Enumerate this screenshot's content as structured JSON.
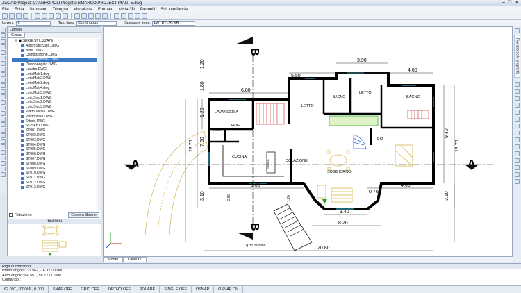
{
  "window": {
    "title": "ZwCAD Project: C:\\AGROPOLI Progetto SMARCO\\PROJECT PIANTE.dwg",
    "minimize": "–",
    "maximize": "□",
    "close": "✕"
  },
  "menu": [
    "File",
    "Edita",
    "Strumenti",
    "Disegna",
    "Visualizza",
    "Formato",
    "Vista 3D",
    "Pannelli",
    "Stili interfaccia"
  ],
  "properties_bar": {
    "layers_label": "Layers",
    "layers_value": "0",
    "linetype_label": "Tipo linea",
    "linetype_value": "Continuous",
    "lineweight_label": "Spessore linea",
    "lineweight_value": "LW_BYLAYER"
  },
  "library": {
    "header": "Librerie",
    "search_tab": "Cerca",
    "root_folder": "SERIE STILIZZATE",
    "items": [
      "AlberoStilizzato.DWG",
      "Bidet.DWG",
      "Composizione.DWG",
      "Composizione2.DWG",
      "DivanoAngolo.DWG",
      "Lavabo.DWG",
      "LettoMatr1.dwg",
      "LettoMatr2.DWG",
      "LettoMatr3.dwg",
      "LettoMatr4.dwg",
      "LettoMatr5.DWG",
      "LettoSing1.DWG",
      "LettoSing2.DWG",
      "LettoSing3.DWG",
      "PiattoDoccia.DWG",
      "Poltroncina.DWG",
      "Sdraio.DWG",
      "ST-SAH1.DWG",
      "ST001.DWG",
      "ST002.DWG",
      "ST003.DWG",
      "ST004.DWG",
      "ST005.DWG",
      "ST006.DWG",
      "ST007.DWG",
      "ST008.DWG",
      "ST009.DWG",
      "ST010.DWG",
      "ST011.DWG",
      "ST012.DWG",
      "ST013.DWG"
    ],
    "selected_index": 3,
    "rotation_label": "Rotazione",
    "explore_button": "Esplora librerie",
    "insert_label": "Inserisci"
  },
  "drawing": {
    "labels": {
      "lavanderia": "LAVANDERIA",
      "disp": "DISP.",
      "frigo": "FRIGO",
      "letto1": "LETTO",
      "bagno1": "BAGNO",
      "letto2": "LETTO",
      "bagno2": "BAGNO",
      "cucina": "CUCINA",
      "snack": "SNACK",
      "colazione": "COLAZIONE",
      "soggiorno": "SOGGIORNO",
      "rip": "RIP",
      "terrain": "q. nf. terreno",
      "b_top": "B",
      "b_bottom": "B",
      "a_left": "A",
      "a_right": "A"
    },
    "dims": {
      "d550": "5.50",
      "d390": "3.90",
      "d460top": "4.60",
      "d680": "6.80",
      "d800": "8.00",
      "d070": "0.70",
      "d460bot": "4.60",
      "d340": "3.40",
      "d820": "8.20",
      "d2080": "20.80",
      "d120a": "1.20",
      "d180": "1.80",
      "d120b": "1.20",
      "d760": "7.60",
      "d1370l": "13.70",
      "d310l": "3.10",
      "d940": "9.40",
      "d1370r": "13.70",
      "d310r": "3.10",
      "d250": "2.50",
      "d120c": "1.20"
    }
  },
  "layout_tabs": [
    "Model",
    "Layout1"
  ],
  "right_tabs": [
    "Finestra delle proprietà"
  ],
  "command": {
    "header": "Riga di comando",
    "line1": "Primo angolo: 31.567,-76.321,0.000",
    "line2": "Altro angolo: 64.551,-55.122,0.000",
    "prompt": "Comando :"
  },
  "status": {
    "coords": "62.097, -77.066 , 0.000",
    "items": [
      "SNAP OFF",
      "GRID OFF",
      "ORTHO OFF",
      "POLARE",
      "SINGLE OFF",
      "OSNAP",
      "OSNAP ON"
    ]
  },
  "colors": {
    "accent": "#3c78c3",
    "wall": "#000000",
    "cad_yellow": "#d9b64a",
    "cad_green": "#25a025",
    "cad_red": "#d02020"
  }
}
